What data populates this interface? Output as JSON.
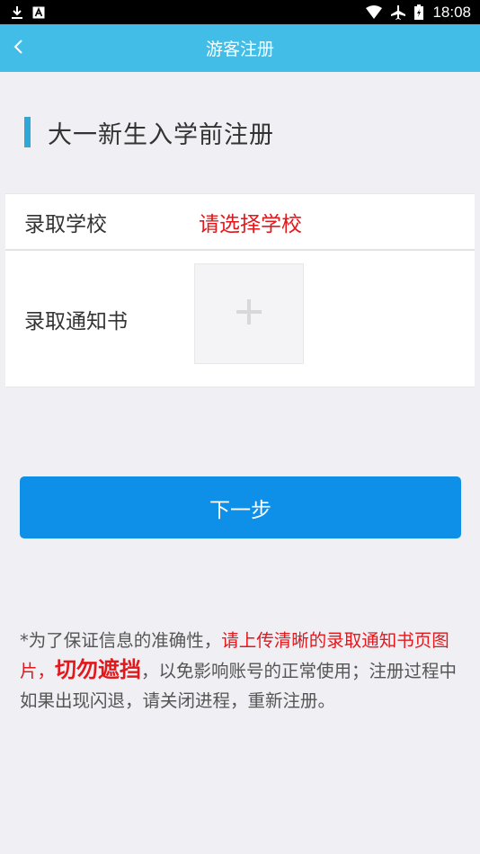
{
  "status_bar": {
    "time": "18:08",
    "icons": [
      "download-icon",
      "notification-a-icon",
      "wifi-icon",
      "airplane-icon",
      "battery-icon"
    ]
  },
  "header": {
    "title": "游客注册",
    "back_icon": "chevron-left-icon"
  },
  "section": {
    "title": "大一新生入学前注册"
  },
  "form": {
    "school_label": "录取学校",
    "school_value": "请选择学校",
    "notice_label": "录取通知书",
    "upload_icon": "plus-icon"
  },
  "next_button": {
    "label": "下一步"
  },
  "notice": {
    "part1": "*为了保证信息的准确性，",
    "part2_red": "请上传清晰的录取通知书页图片，",
    "part3_red_bold": "切勿遮挡",
    "part4": "，以免影响账号的正常使用；注册过程中如果出现闪退，请关闭进程，重新注册。"
  },
  "colors": {
    "header_bg": "#42bde8",
    "accent_bar": "#2fa8d8",
    "button_bg": "#0e90e8",
    "warning_red": "#e4171b",
    "page_bg": "#efeff4"
  }
}
